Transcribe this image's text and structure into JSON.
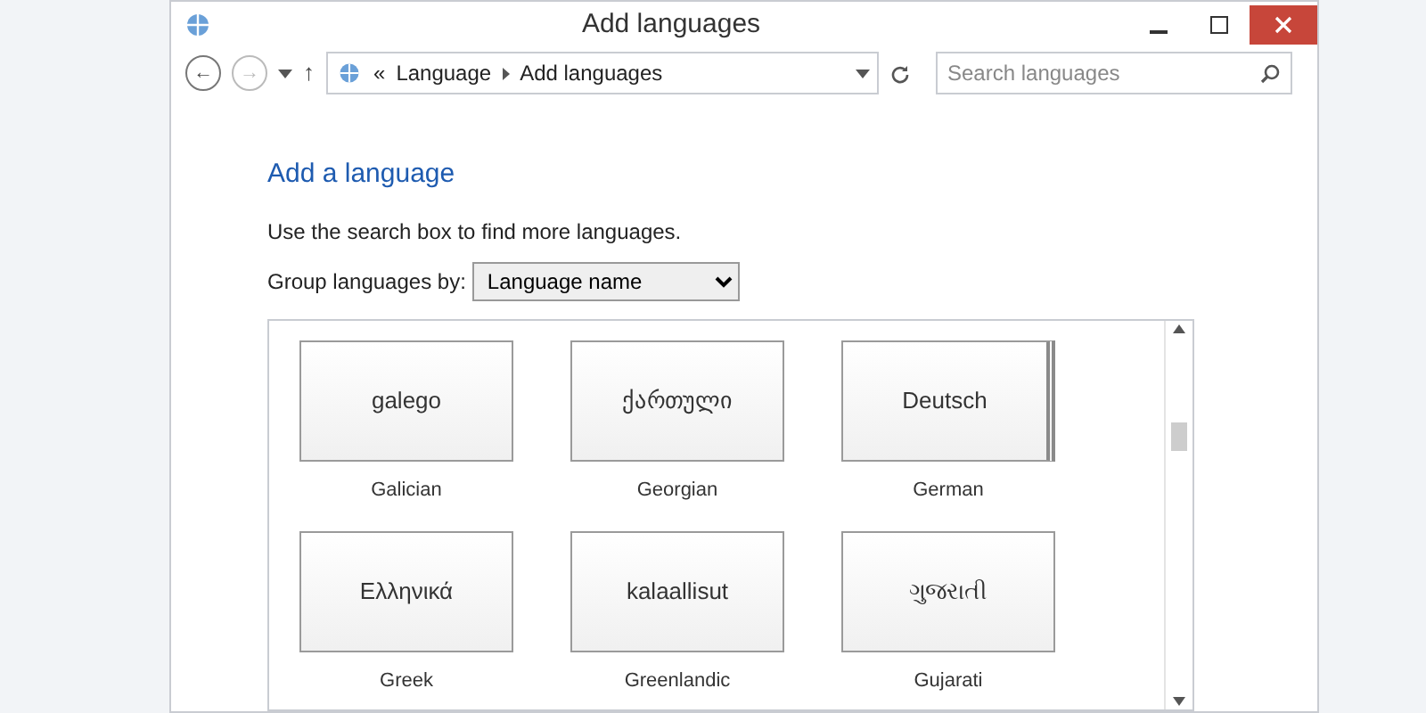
{
  "window": {
    "title": "Add languages"
  },
  "address_bar": {
    "back": "←",
    "forward": "→",
    "up": "↑",
    "separator": "«",
    "path": [
      "Language",
      "Add languages"
    ],
    "search_placeholder": "Search languages"
  },
  "heading": "Add a language",
  "hint": "Use the search box to find more languages.",
  "group_by": {
    "label": "Group languages by:",
    "value": "Language name"
  },
  "languages": [
    {
      "native": "galego",
      "name": "Galician",
      "stacked": false
    },
    {
      "native": "ქართული",
      "name": "Georgian",
      "stacked": false
    },
    {
      "native": "Deutsch",
      "name": "German",
      "stacked": true
    },
    {
      "native": "Ελληνικά",
      "name": "Greek",
      "stacked": false
    },
    {
      "native": "kalaallisut",
      "name": "Greenlandic",
      "stacked": false
    },
    {
      "native": "ગુજરાતી",
      "name": "Gujarati",
      "stacked": false
    }
  ]
}
